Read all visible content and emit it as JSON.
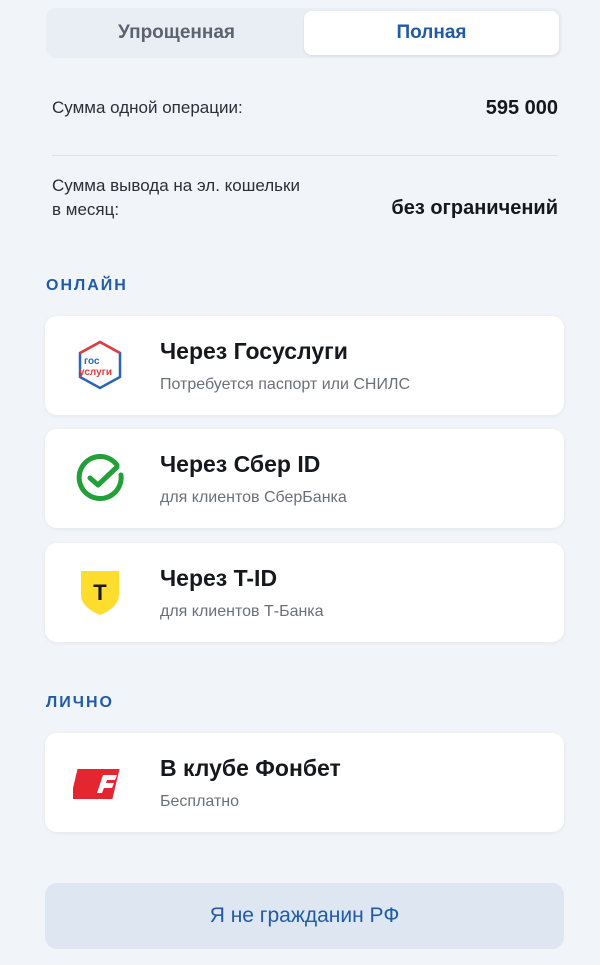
{
  "tabs": {
    "simplified": "Упрощенная",
    "full": "Полная"
  },
  "limits": {
    "single_operation_label": "Сумма одной операции:",
    "single_operation_value": "595 000",
    "withdraw_label_line1": "Сумма вывода на эл. кошельки",
    "withdraw_label_line2": "в месяц:",
    "withdraw_value": "без ограничений"
  },
  "sections": {
    "online": "ОНЛАЙН",
    "personal": "ЛИЧНО"
  },
  "options": {
    "gosuslugi": {
      "title": "Через Госуслуги",
      "subtitle": "Потребуется паспорт или СНИЛС",
      "logo_line1": "гос",
      "logo_line2": "услуги"
    },
    "sber": {
      "title": "Через Сбер ID",
      "subtitle": "для клиентов СберБанка"
    },
    "tid": {
      "title": "Через T-ID",
      "subtitle": "для клиентов Т-Банка",
      "logo_letter": "Т"
    },
    "fonbet": {
      "title": "В клубе Фонбет",
      "subtitle": "Бесплатно"
    }
  },
  "not_citizen_button": "Я не гражданин РФ",
  "colors": {
    "accent": "#1f5ba8",
    "sber_green": "#21a038",
    "tbank_yellow": "#ffdd2d",
    "fonbet_red": "#e3262f",
    "gos_red": "#e53b3b",
    "gos_blue": "#2a64b8"
  }
}
